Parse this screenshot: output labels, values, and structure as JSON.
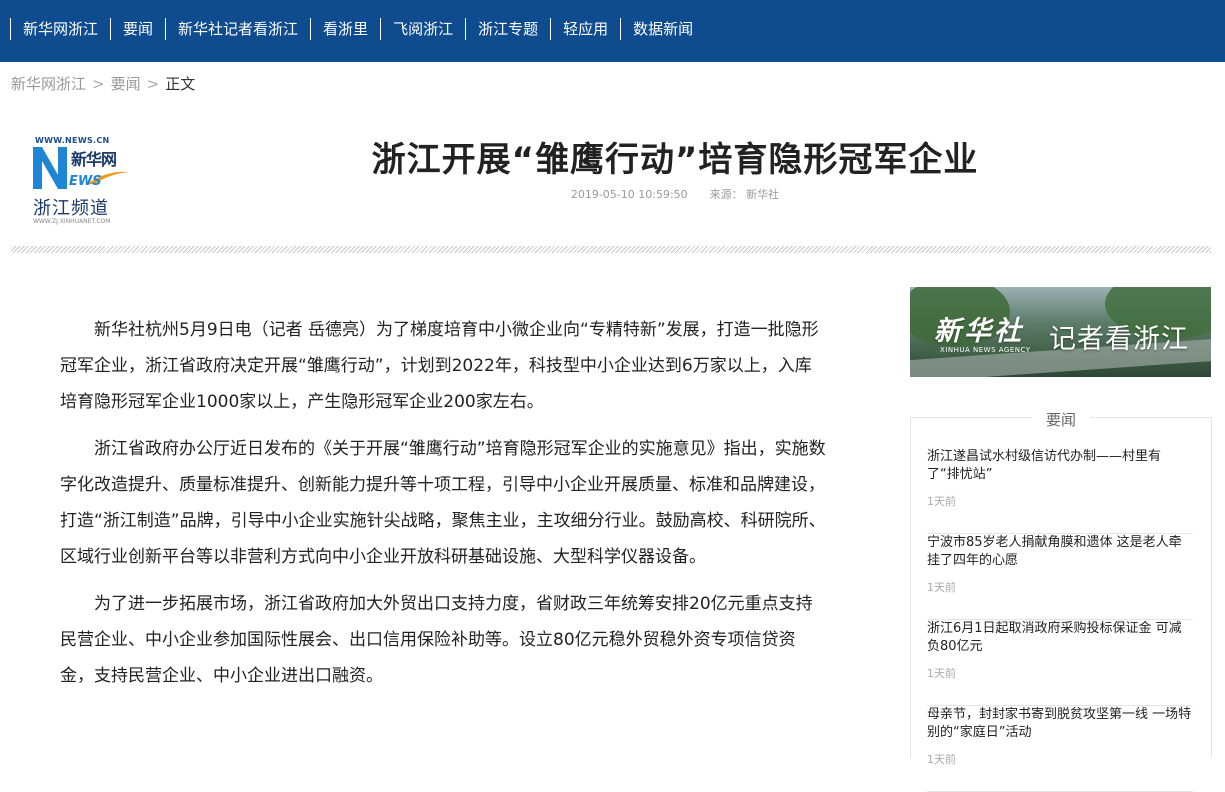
{
  "nav": [
    "新华网浙江",
    "要闻",
    "新华社记者看浙江",
    "看浙里",
    "飞阅浙江",
    "浙江专题",
    "轻应用",
    "数据新闻"
  ],
  "breadcrumb": {
    "home": "新华网浙江",
    "section": "要闻",
    "current": "正文",
    "sep": ">"
  },
  "logo": {
    "url": "WWW.NEWS.CN",
    "brand": "新华网",
    "news": "EWS",
    "channel": "浙江频道",
    "site": "WWW.ZJ.XINHUANET.COM"
  },
  "article": {
    "title": "浙江开展“雏鹰行动”培育隐形冠军企业",
    "datetime": "2019-05-10 10:59:50",
    "source": "来源：  新华社",
    "paragraphs": [
      "新华社杭州5月9日电（记者 岳德亮）为了梯度培育中小微企业向“专精特新”发展，打造一批隐形冠军企业，浙江省政府决定开展“雏鹰行动”，计划到2022年，科技型中小企业达到6万家以上，入库培育隐形冠军企业1000家以上，产生隐形冠军企业200家左右。",
      "浙江省政府办公厅近日发布的《关于开展“雏鹰行动”培育隐形冠军企业的实施意见》指出，实施数字化改造提升、质量标准提升、创新能力提升等十项工程，引导中小企业开展质量、标准和品牌建设，打造“浙江制造”品牌，引导中小企业实施针尖战略，聚焦主业，主攻细分行业。鼓励高校、科研院所、区域行业创新平台等以非营利方式向中小企业开放科研基础设施、大型科学仪器设备。",
      "为了进一步拓展市场，浙江省政府加大外贸出口支持力度，省财政三年统筹安排20亿元重点支持民营企业、中小企业参加国际性展会、出口信用保险补助等。设立80亿元稳外贸稳外资专项信贷资金，支持民营企业、中小企业进出口融资。"
    ]
  },
  "banner": {
    "calligraphy": "新华社",
    "english": "XINHUA NEWS AGENCY",
    "text": "记者看浙江"
  },
  "sidebar": {
    "heading": "要闻",
    "items": [
      {
        "title": "浙江遂昌试水村级信访代办制——村里有了“排忧站”",
        "time": "1天前"
      },
      {
        "title": "宁波市85岁老人捐献角膜和遗体 这是老人牵挂了四年的心愿",
        "time": "1天前"
      },
      {
        "title": "浙江6月1日起取消政府采购投标保证金 可减负80亿元",
        "time": "1天前"
      },
      {
        "title": "母亲节，封封家书寄到脱贫攻坚第一线 一场特别的“家庭日”活动",
        "time": "1天前"
      }
    ]
  },
  "colors": {
    "nav_bg": "#0f4c8f",
    "nav_text": "#ffffff",
    "meta": "#999999"
  }
}
